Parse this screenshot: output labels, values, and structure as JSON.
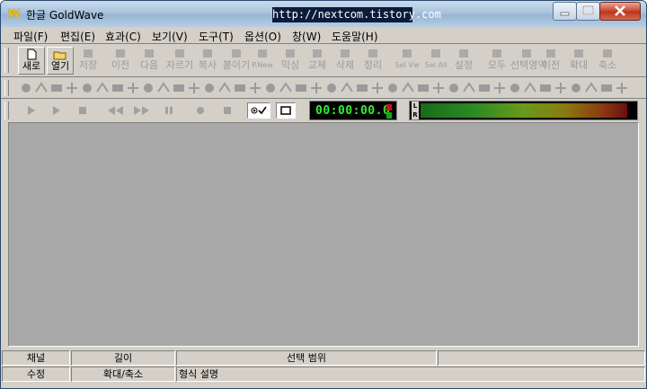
{
  "window": {
    "title": "한글 GoldWave",
    "watermark": "http://nextcom.tistory.com",
    "app_icon_glyph": "W",
    "controls": [
      "minimize-icon",
      "maximize-icon",
      "close-icon"
    ]
  },
  "menu": [
    {
      "label": "파일(F)"
    },
    {
      "label": "편집(E)"
    },
    {
      "label": "효과(C)"
    },
    {
      "label": "보기(V)"
    },
    {
      "label": "도구(T)"
    },
    {
      "label": "옵션(O)"
    },
    {
      "label": "창(W)"
    },
    {
      "label": "도움말(H)"
    }
  ],
  "toolbar_main": [
    {
      "label": "새로",
      "icon": "new-file-icon",
      "enabled": true
    },
    {
      "label": "열기",
      "icon": "open-folder-icon",
      "enabled": true
    },
    {
      "label": "저장",
      "icon": "save-icon",
      "enabled": false
    },
    {
      "label": "이전",
      "icon": "undo-icon",
      "enabled": false
    },
    {
      "label": "다음",
      "icon": "redo-icon",
      "enabled": false
    },
    {
      "label": "자르기",
      "icon": "cut-icon",
      "enabled": false
    },
    {
      "label": "복사",
      "icon": "copy-icon",
      "enabled": false
    },
    {
      "label": "붙이기",
      "icon": "paste-icon",
      "enabled": false
    },
    {
      "label": "P.New",
      "icon": "paste-new-icon",
      "enabled": false
    },
    {
      "label": "믹싱",
      "icon": "mix-icon",
      "enabled": false
    },
    {
      "label": "교체",
      "icon": "replace-icon",
      "enabled": false
    },
    {
      "label": "삭제",
      "icon": "delete-icon",
      "enabled": false
    },
    {
      "label": "정리",
      "icon": "trim-icon",
      "enabled": false
    },
    {
      "label": "Sel Vw",
      "icon": "select-view-icon",
      "enabled": false
    },
    {
      "label": "Sel All",
      "icon": "select-all-icon",
      "enabled": false
    },
    {
      "label": "설정",
      "icon": "settings-icon",
      "enabled": false
    },
    {
      "label": "모두",
      "icon": "zoom-all-icon",
      "enabled": false
    },
    {
      "label": "선택영역",
      "icon": "zoom-selection-icon",
      "enabled": false
    },
    {
      "label": "이전",
      "icon": "zoom-previous-icon",
      "enabled": false
    },
    {
      "label": "확대",
      "icon": "zoom-in-icon",
      "enabled": false
    },
    {
      "label": "축소",
      "icon": "zoom-out-icon",
      "enabled": false
    }
  ],
  "effects_toolbar": [
    "doppler-icon",
    "dynamics-icon",
    "echo-icon",
    "equalizer-icon",
    "fade-in-icon",
    "fade-out-icon",
    "filter-icon",
    "flanger-icon",
    "invert-icon",
    "mechanize-icon",
    "offset-icon",
    "pan-icon",
    "pitch-icon",
    "resample-icon",
    "reverse-icon",
    "silence-icon",
    "speed-icon",
    "stereo-icon",
    "time-warp-icon",
    "volume-icon",
    "noise-icon",
    "clip-icon",
    "spectrum-icon",
    "hz-icon",
    "channel-icon",
    "help-icon",
    "compress-icon",
    "expand-icon",
    "match-icon",
    "marker-icon",
    "auto-trim-icon",
    "bandpass-icon",
    "low-pass-icon",
    "high-pass-icon",
    "smooth-icon",
    "dither-icon",
    "pop-icon",
    "click-icon",
    "hum-icon",
    "hiss-icon"
  ],
  "transport": {
    "buttons": [
      {
        "name": "play-button",
        "icon": "play-icon"
      },
      {
        "name": "play-selection-button",
        "icon": "play-selection-icon"
      },
      {
        "name": "stop-button",
        "icon": "stop-icon"
      },
      {
        "name": "rewind-button",
        "icon": "rewind-icon"
      },
      {
        "name": "fast-forward-button",
        "icon": "fast-forward-icon"
      },
      {
        "name": "pause-button",
        "icon": "pause-icon"
      },
      {
        "name": "record-button",
        "icon": "record-icon"
      },
      {
        "name": "stop-record-button",
        "icon": "stop-record-icon"
      }
    ],
    "time": "00:00:00.0",
    "level_labels": "L R"
  },
  "status": {
    "row1": [
      "채널",
      "길이",
      "선택 범위",
      ""
    ],
    "row2": [
      "수정",
      "확대/축소",
      "형식 설명"
    ]
  },
  "colors": {
    "time_text": "#33ee33",
    "workspace": "#a8a8a8",
    "chrome": "#d4d0c8"
  }
}
